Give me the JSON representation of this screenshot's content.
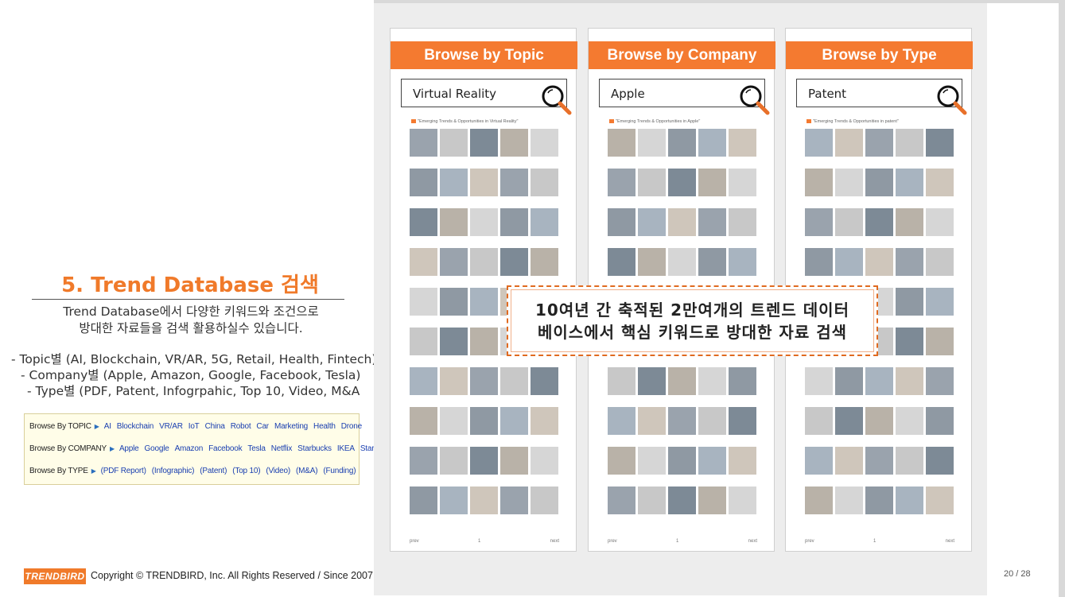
{
  "left": {
    "title": "5. Trend Database 검색",
    "desc_line1": "Trend Database에서 다양한 키워드와 조건으로",
    "desc_line2": "방대한 자료들을 검색 활용하실수 있습니다.",
    "bullets": [
      "- Topic별 (AI, Blockchain, VR/AR, 5G, Retail, Health, Fintech)",
      "- Company별 (Apple, Amazon, Google, Facebook, Tesla)",
      "- Type별 (PDF, Patent, Infogrpahic, Top 10, Video, M&A"
    ],
    "browse": {
      "topic_label": "Browse By TOPIC",
      "topic_links": [
        "AI",
        "Blockchain",
        "VR/AR",
        "IoT",
        "China",
        "Robot",
        "Car",
        "Marketing",
        "Health",
        "Drone"
      ],
      "company_label": "Browse By COMPANY",
      "company_links": [
        "Apple",
        "Google",
        "Amazon",
        "Facebook",
        "Tesla",
        "Netflix",
        "Starbucks",
        "IKEA",
        "Startups"
      ],
      "type_label": "Browse By TYPE",
      "type_links": [
        "(PDF Report)",
        "(Infographic)",
        "(Patent)",
        "(Top 10)",
        "(Video)",
        "(M&A)",
        "(Funding)"
      ]
    }
  },
  "footer": {
    "logo": "TRENDBIRD",
    "copyright": "Copyright © TRENDBIRD, Inc.  All Rights Reserved / Since 2007",
    "page": "20 / 28"
  },
  "columns": [
    {
      "header": "Browse by Topic",
      "search_value": "Virtual Reality",
      "results_title": "\"Emerging Trends & Opportunities in Virtual Reality\"",
      "prev": "prev",
      "next": "next",
      "page": "1"
    },
    {
      "header": "Browse by Company",
      "search_value": "Apple",
      "results_title": "\"Emerging Trends & Opportunities in Apple\"",
      "prev": "prev",
      "next": "next",
      "page": "1"
    },
    {
      "header": "Browse by Type",
      "search_value": "Patent",
      "results_title": "\"Emerging Trends & Opportunities in patent\"",
      "prev": "prev",
      "next": "next",
      "page": "1"
    }
  ],
  "overlay": {
    "line1": "10여년 간 축적된 2만여개의 트렌드 데이터",
    "line2": "베이스에서 핵심 키워드로 방대한 자료 검색"
  },
  "colors": {
    "accent": "#f47a30",
    "title_orange": "#f07a2a",
    "link_blue": "#1a3fb0"
  }
}
